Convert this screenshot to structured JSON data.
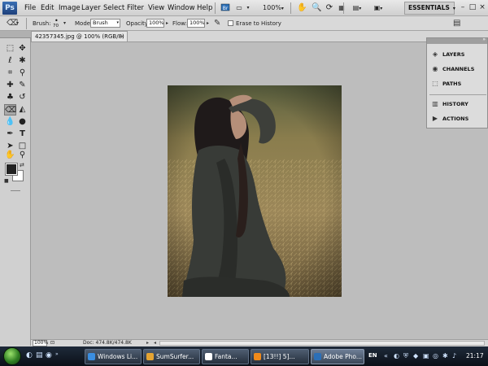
{
  "app": {
    "logo": "Ps",
    "menus": [
      "File",
      "Edit",
      "Image",
      "Layer",
      "Select",
      "Filter",
      "View",
      "Window",
      "Help"
    ],
    "zoom_percent": "100%",
    "workspace": "ESSENTIALS",
    "window_controls": [
      "–",
      "□",
      "×"
    ]
  },
  "options_bar": {
    "brush_label": "Brush:",
    "brush_size": "70",
    "mode_label": "Mode:",
    "mode_value": "Brush",
    "opacity_label": "Opacity:",
    "opacity_value": "100%",
    "flow_label": "Flow:",
    "flow_value": "100%",
    "erase_history_label": "Erase to History"
  },
  "document": {
    "tab_title": "42357345.jpg @ 100% (RGB/8)",
    "tab_close": "×",
    "status_zoom": "100%",
    "status_doc": "Doc: 474.8K/474.8K"
  },
  "panels": [
    {
      "label": "LAYERS",
      "icon": "layers-icon"
    },
    {
      "label": "CHANNELS",
      "icon": "channels-icon"
    },
    {
      "label": "PATHS",
      "icon": "paths-icon"
    },
    {
      "label": "HISTORY",
      "icon": "history-icon"
    },
    {
      "label": "ACTIONS",
      "icon": "actions-icon"
    }
  ],
  "taskbar": {
    "buttons": [
      "Windows Li...",
      "SumSurfer...",
      "Fanta...",
      "[13!!] 5]...",
      "Adobe Pho..."
    ],
    "language": "EN",
    "clock": "21:17"
  },
  "colors": {
    "foreground": "#222222",
    "background": "#ffffff",
    "canvas_bg": "#bdbdbd",
    "taskbar": "#16202c"
  }
}
